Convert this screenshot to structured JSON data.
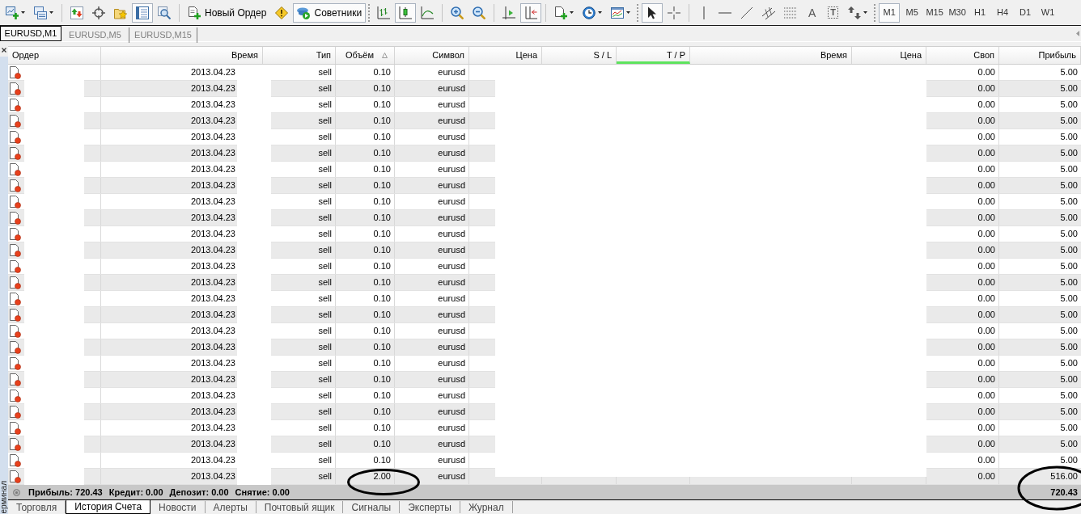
{
  "toolbar": {
    "tools": [
      {
        "kind": "icon",
        "pressed": false,
        "menu": true
      },
      {
        "kind": "icon",
        "pressed": false,
        "menu": true
      },
      {
        "kind": "separator"
      },
      {
        "kind": "icon",
        "pressed": false,
        "menu": false
      },
      {
        "kind": "icon",
        "pressed": false,
        "menu": false
      },
      {
        "kind": "icon",
        "pressed": false,
        "menu": false
      },
      {
        "kind": "icon",
        "pressed": true,
        "menu": false
      },
      {
        "kind": "icon",
        "pressed": false,
        "menu": false
      },
      {
        "kind": "separator"
      },
      {
        "kind": "button",
        "label": "Новый Ордер",
        "pressed": false
      },
      {
        "kind": "icon",
        "pressed": false,
        "menu": false
      },
      {
        "kind": "button",
        "label": "Советники",
        "pressed": true
      },
      {
        "kind": "grip"
      },
      {
        "kind": "icon",
        "pressed": false,
        "menu": false
      },
      {
        "kind": "icon",
        "pressed": true,
        "menu": false
      },
      {
        "kind": "icon",
        "pressed": false,
        "menu": false
      },
      {
        "kind": "separator"
      },
      {
        "kind": "icon",
        "pressed": false,
        "menu": false
      },
      {
        "kind": "icon",
        "pressed": false,
        "menu": false
      },
      {
        "kind": "separator"
      },
      {
        "kind": "icon",
        "pressed": false,
        "menu": false
      },
      {
        "kind": "icon",
        "pressed": true,
        "menu": false
      },
      {
        "kind": "separator"
      },
      {
        "kind": "icon",
        "pressed": false,
        "menu": true
      },
      {
        "kind": "icon",
        "pressed": false,
        "menu": true
      },
      {
        "kind": "icon",
        "pressed": false,
        "menu": true
      },
      {
        "kind": "grip"
      },
      {
        "kind": "icon",
        "pressed": true,
        "menu": false
      },
      {
        "kind": "icon",
        "pressed": false,
        "menu": false
      },
      {
        "kind": "separator"
      },
      {
        "kind": "icon",
        "pressed": false,
        "menu": false
      },
      {
        "kind": "icon",
        "pressed": false,
        "menu": false
      },
      {
        "kind": "icon",
        "pressed": false,
        "menu": false
      },
      {
        "kind": "icon",
        "pressed": false,
        "menu": false
      },
      {
        "kind": "icon",
        "pressed": false,
        "menu": false
      },
      {
        "kind": "glyph",
        "label": "A",
        "framed": false,
        "pressed": false
      },
      {
        "kind": "glyph",
        "label": "T",
        "framed": true,
        "pressed": false
      },
      {
        "kind": "icon",
        "pressed": false,
        "menu": true
      },
      {
        "kind": "grip"
      }
    ],
    "timeframes": [
      {
        "label": "M1",
        "selected": true
      },
      {
        "label": "M5",
        "selected": false
      },
      {
        "label": "M15",
        "selected": false
      },
      {
        "label": "M30",
        "selected": false
      },
      {
        "label": "H1",
        "selected": false
      },
      {
        "label": "H4",
        "selected": false
      },
      {
        "label": "D1",
        "selected": false
      },
      {
        "label": "W1",
        "selected": false
      }
    ]
  },
  "chart_tabs": [
    {
      "label": "EURUSD,M1",
      "selected": true
    },
    {
      "label": "EURUSD,M5",
      "selected": false
    },
    {
      "label": "EURUSD,M15",
      "selected": false
    }
  ],
  "terminal": {
    "side_label": "ерминал",
    "table": {
      "columns": [
        {
          "label": "Ордер",
          "sorted": false,
          "highlighted": false
        },
        {
          "label": "Время",
          "sorted": false,
          "highlighted": false
        },
        {
          "label": "Тип",
          "sorted": false,
          "highlighted": false
        },
        {
          "label": "Объём",
          "sorted": true,
          "highlighted": false
        },
        {
          "label": "Символ",
          "sorted": false,
          "highlighted": false
        },
        {
          "label": "Цена",
          "sorted": false,
          "highlighted": false
        },
        {
          "label": "S / L",
          "sorted": false,
          "highlighted": false
        },
        {
          "label": "T / P",
          "sorted": false,
          "highlighted": true
        },
        {
          "label": "Время",
          "sorted": false,
          "highlighted": false
        },
        {
          "label": "Цена",
          "sorted": false,
          "highlighted": false
        },
        {
          "label": "Своп",
          "sorted": false,
          "highlighted": false
        },
        {
          "label": "Прибыль",
          "sorted": false,
          "highlighted": false
        }
      ],
      "rows": [
        {
          "date": "2013.04.23",
          "type": "sell",
          "volume": "0.10",
          "symbol": "eurusd",
          "swap": "0.00",
          "profit": "5.00",
          "volume_circled": false
        },
        {
          "date": "2013.04.23",
          "type": "sell",
          "volume": "0.10",
          "symbol": "eurusd",
          "swap": "0.00",
          "profit": "5.00",
          "volume_circled": false
        },
        {
          "date": "2013.04.23",
          "type": "sell",
          "volume": "0.10",
          "symbol": "eurusd",
          "swap": "0.00",
          "profit": "5.00",
          "volume_circled": false
        },
        {
          "date": "2013.04.23",
          "type": "sell",
          "volume": "0.10",
          "symbol": "eurusd",
          "swap": "0.00",
          "profit": "5.00",
          "volume_circled": false
        },
        {
          "date": "2013.04.23",
          "type": "sell",
          "volume": "0.10",
          "symbol": "eurusd",
          "swap": "0.00",
          "profit": "5.00",
          "volume_circled": false
        },
        {
          "date": "2013.04.23",
          "type": "sell",
          "volume": "0.10",
          "symbol": "eurusd",
          "swap": "0.00",
          "profit": "5.00",
          "volume_circled": false
        },
        {
          "date": "2013.04.23",
          "type": "sell",
          "volume": "0.10",
          "symbol": "eurusd",
          "swap": "0.00",
          "profit": "5.00",
          "volume_circled": false
        },
        {
          "date": "2013.04.23",
          "type": "sell",
          "volume": "0.10",
          "symbol": "eurusd",
          "swap": "0.00",
          "profit": "5.00",
          "volume_circled": false
        },
        {
          "date": "2013.04.23",
          "type": "sell",
          "volume": "0.10",
          "symbol": "eurusd",
          "swap": "0.00",
          "profit": "5.00",
          "volume_circled": false
        },
        {
          "date": "2013.04.23",
          "type": "sell",
          "volume": "0.10",
          "symbol": "eurusd",
          "swap": "0.00",
          "profit": "5.00",
          "volume_circled": false
        },
        {
          "date": "2013.04.23",
          "type": "sell",
          "volume": "0.10",
          "symbol": "eurusd",
          "swap": "0.00",
          "profit": "5.00",
          "volume_circled": false
        },
        {
          "date": "2013.04.23",
          "type": "sell",
          "volume": "0.10",
          "symbol": "eurusd",
          "swap": "0.00",
          "profit": "5.00",
          "volume_circled": false
        },
        {
          "date": "2013.04.23",
          "type": "sell",
          "volume": "0.10",
          "symbol": "eurusd",
          "swap": "0.00",
          "profit": "5.00",
          "volume_circled": false
        },
        {
          "date": "2013.04.23",
          "type": "sell",
          "volume": "0.10",
          "symbol": "eurusd",
          "swap": "0.00",
          "profit": "5.00",
          "volume_circled": false
        },
        {
          "date": "2013.04.23",
          "type": "sell",
          "volume": "0.10",
          "symbol": "eurusd",
          "swap": "0.00",
          "profit": "5.00",
          "volume_circled": false
        },
        {
          "date": "2013.04.23",
          "type": "sell",
          "volume": "0.10",
          "symbol": "eurusd",
          "swap": "0.00",
          "profit": "5.00",
          "volume_circled": false
        },
        {
          "date": "2013.04.23",
          "type": "sell",
          "volume": "0.10",
          "symbol": "eurusd",
          "swap": "0.00",
          "profit": "5.00",
          "volume_circled": false
        },
        {
          "date": "2013.04.23",
          "type": "sell",
          "volume": "0.10",
          "symbol": "eurusd",
          "swap": "0.00",
          "profit": "5.00",
          "volume_circled": false
        },
        {
          "date": "2013.04.23",
          "type": "sell",
          "volume": "0.10",
          "symbol": "eurusd",
          "swap": "0.00",
          "profit": "5.00",
          "volume_circled": false
        },
        {
          "date": "2013.04.23",
          "type": "sell",
          "volume": "0.10",
          "symbol": "eurusd",
          "swap": "0.00",
          "profit": "5.00",
          "volume_circled": false
        },
        {
          "date": "2013.04.23",
          "type": "sell",
          "volume": "0.10",
          "symbol": "eurusd",
          "swap": "0.00",
          "profit": "5.00",
          "volume_circled": false
        },
        {
          "date": "2013.04.23",
          "type": "sell",
          "volume": "0.10",
          "symbol": "eurusd",
          "swap": "0.00",
          "profit": "5.00",
          "volume_circled": false
        },
        {
          "date": "2013.04.23",
          "type": "sell",
          "volume": "0.10",
          "symbol": "eurusd",
          "swap": "0.00",
          "profit": "5.00",
          "volume_circled": false
        },
        {
          "date": "2013.04.23",
          "type": "sell",
          "volume": "0.10",
          "symbol": "eurusd",
          "swap": "0.00",
          "profit": "5.00",
          "volume_circled": false
        },
        {
          "date": "2013.04.23",
          "type": "sell",
          "volume": "0.10",
          "symbol": "eurusd",
          "swap": "0.00",
          "profit": "5.00",
          "volume_circled": false
        },
        {
          "date": "2013.04.23",
          "type": "sell",
          "volume": "2.00",
          "symbol": "eurusd",
          "swap": "0.00",
          "profit": "516.00",
          "volume_circled": true
        }
      ]
    },
    "summary": {
      "items": [
        "Прибыль: 720.43",
        "Кредит: 0.00",
        "Депозит: 0.00",
        "Снятие: 0.00"
      ],
      "total": "720.43",
      "total_circled": true
    },
    "tabs": [
      {
        "label": "Торговля",
        "selected": false
      },
      {
        "label": "История Счета",
        "selected": true
      },
      {
        "label": "Новости",
        "selected": false
      },
      {
        "label": "Алерты",
        "selected": false
      },
      {
        "label": "Почтовый ящик",
        "selected": false
      },
      {
        "label": "Сигналы",
        "selected": false
      },
      {
        "label": "Эксперты",
        "selected": false
      },
      {
        "label": "Журнал",
        "selected": false
      }
    ]
  }
}
